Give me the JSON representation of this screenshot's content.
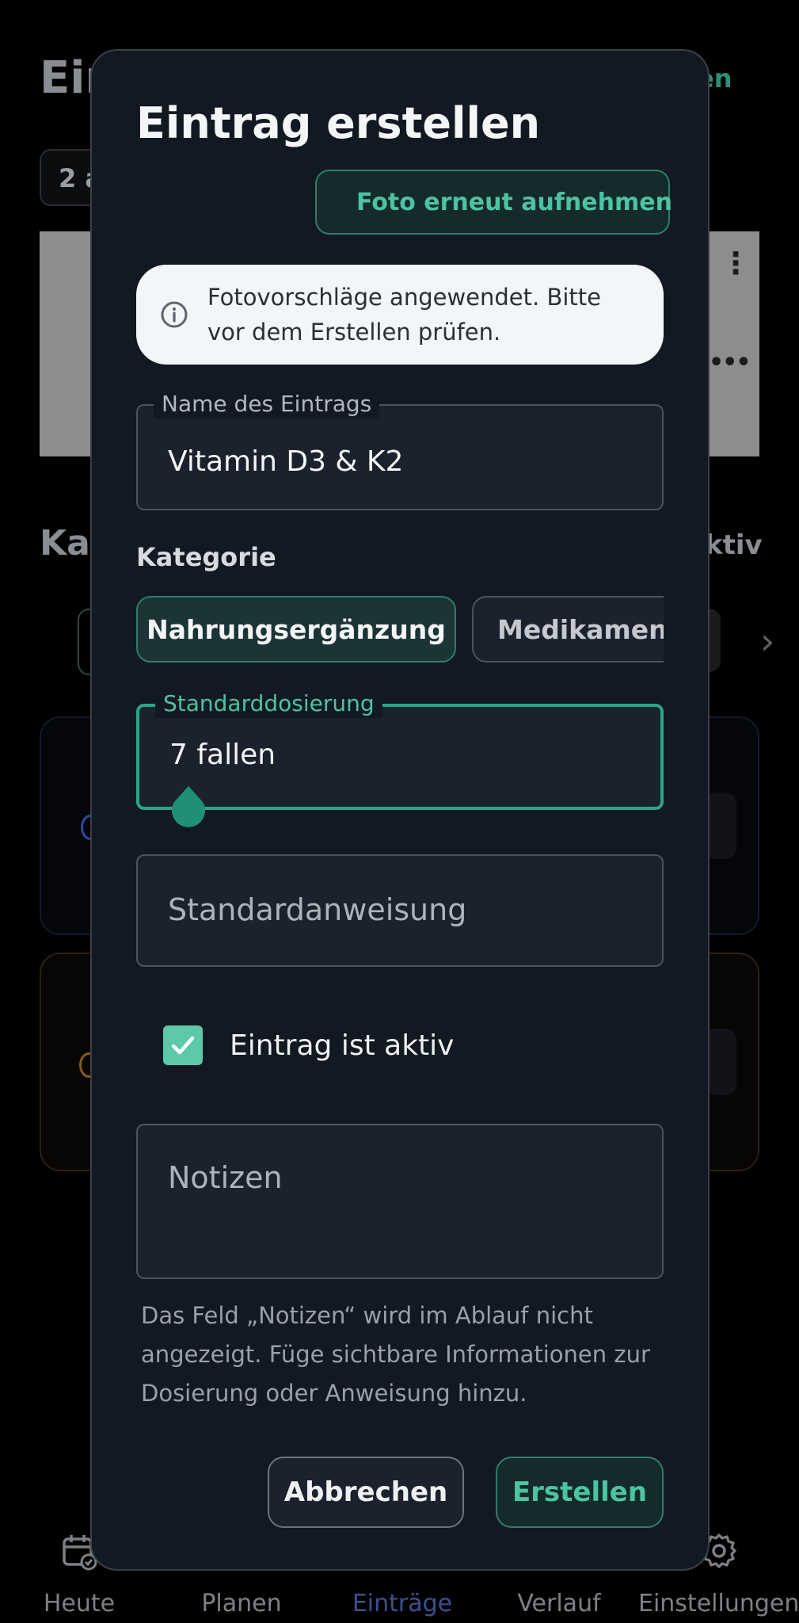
{
  "background": {
    "title_partial": "Ein",
    "right_link_partial": "en",
    "chip_partial": "2 a",
    "section_partial": "Ka",
    "section_right_partial": "ktiv",
    "tab_partial": "t"
  },
  "bottom_nav": {
    "items": [
      {
        "label": "Heute",
        "icon": "calendar-check-icon"
      },
      {
        "label": "Planen",
        "icon": "plan-icon"
      },
      {
        "label": "Einträge",
        "icon": "entries-icon",
        "active": true
      },
      {
        "label": "Verlauf",
        "icon": "history-icon"
      },
      {
        "label": "Einstellungen",
        "icon": "gear-icon"
      }
    ]
  },
  "dialog": {
    "title": "Eintrag erstellen",
    "retake_photo_label": "Foto erneut aufnehmen",
    "info_banner": "Fotovorschläge angewendet. Bitte vor dem Erstellen prüfen.",
    "name_field": {
      "label": "Name des Eintrags",
      "value": "Vitamin D3 & K2"
    },
    "category": {
      "label": "Kategorie",
      "options": [
        {
          "label": "Nahrungsergänzung",
          "selected": true
        },
        {
          "label": "Medikament",
          "selected": false
        }
      ]
    },
    "dosage_field": {
      "label": "Standarddosierung",
      "value": "7 fallen"
    },
    "instruction_field": {
      "placeholder": "Standardanweisung"
    },
    "active_checkbox": {
      "label": "Eintrag ist aktiv",
      "checked": true
    },
    "notes_field": {
      "placeholder": "Notizen"
    },
    "notes_hint": "Das Feld „Notizen“ wird im Ablauf nicht angezeigt. Füge sichtbare Informationen zur Dosierung oder Anweisung hinzu.",
    "cancel_label": "Abbrechen",
    "create_label": "Erstellen"
  },
  "colors": {
    "accent": "#4cc3a3",
    "dialog_bg": "#121922",
    "field_bg": "#1b222d",
    "active_nav": "#3f4f8f"
  }
}
